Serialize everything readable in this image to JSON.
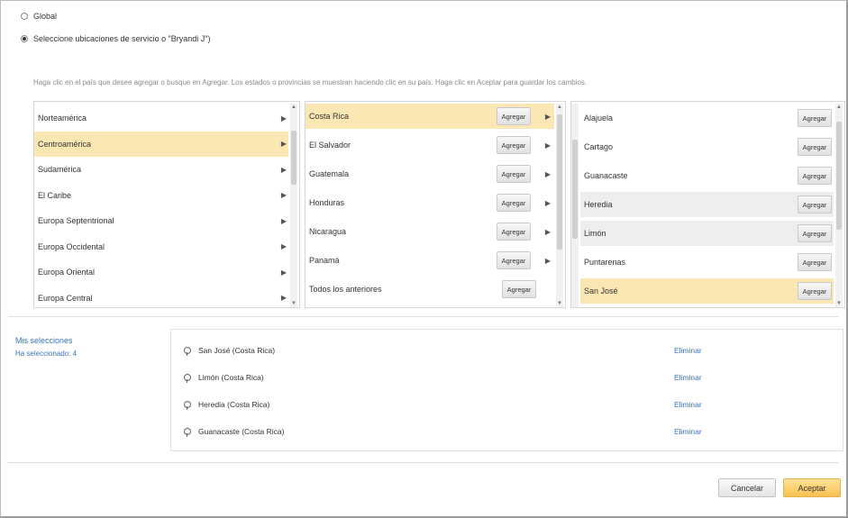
{
  "radios": [
    {
      "label": "Global",
      "checked": false
    },
    {
      "label": "Seleccione ubicaciones de servicio o \"Bryandi J\")",
      "checked": true
    }
  ],
  "instructions": "Haga clic en el país que desee agregar o busque en Agregar. Los estados o provincias se muestran haciendo clic en su país. Haga clic en Aceptar para guardar los cambios.",
  "regions": [
    {
      "label": "Norteamérica",
      "state": "normal"
    },
    {
      "label": "Centroamérica",
      "state": "selected"
    },
    {
      "label": "Sudamérica",
      "state": "normal"
    },
    {
      "label": "El Caribe",
      "state": "normal"
    },
    {
      "label": "Europa Septentrional",
      "state": "normal"
    },
    {
      "label": "Europa Occidental",
      "state": "normal"
    },
    {
      "label": "Europa Oriental",
      "state": "normal"
    },
    {
      "label": "Europa Central",
      "state": "normal"
    }
  ],
  "countries": [
    {
      "label": "Costa Rica",
      "state": "selected",
      "button": "Agregar",
      "arrow": true
    },
    {
      "label": "El Salvador",
      "state": "normal",
      "button": "Agregar",
      "arrow": true
    },
    {
      "label": "Guatemala",
      "state": "normal",
      "button": "Agregar",
      "arrow": true
    },
    {
      "label": "Honduras",
      "state": "normal",
      "button": "Agregar",
      "arrow": true
    },
    {
      "label": "Nicaragua",
      "state": "normal",
      "button": "Agregar",
      "arrow": true
    },
    {
      "label": "Panamá",
      "state": "normal",
      "button": "Agregar",
      "arrow": true
    },
    {
      "label": "Todos los anteriores",
      "state": "normal",
      "button": "Agregar",
      "arrow": false
    }
  ],
  "provinces": [
    {
      "label": "Alajuela",
      "state": "normal",
      "button": "Agregar"
    },
    {
      "label": "Cartago",
      "state": "normal",
      "button": "Agregar"
    },
    {
      "label": "Guanacaste",
      "state": "normal",
      "button": "Agregar"
    },
    {
      "label": "Heredia",
      "state": "hover",
      "button": "Agregar"
    },
    {
      "label": "Limón",
      "state": "hover",
      "button": "Agregar"
    },
    {
      "label": "Puntarenas",
      "state": "normal",
      "button": "Agregar"
    },
    {
      "label": "San José",
      "state": "selected",
      "button": "Agregar"
    }
  ],
  "selections": {
    "label": "Mis selecciones",
    "count_text": "Ha seleccionado: 4",
    "items": [
      {
        "name": "San José (Costa Rica)",
        "remove": "Eliminar"
      },
      {
        "name": "Limón (Costa Rica)",
        "remove": "Eliminar"
      },
      {
        "name": "Heredia (Costa Rica)",
        "remove": "Eliminar"
      },
      {
        "name": "Guanacaste (Costa Rica)",
        "remove": "Eliminar"
      }
    ]
  },
  "footer": {
    "cancel": "Cancelar",
    "accept": "Aceptar"
  },
  "colors": {
    "selected_bg": "#fbe7b3",
    "link": "#3b73b9",
    "accept_bg": "#f7c04f"
  }
}
